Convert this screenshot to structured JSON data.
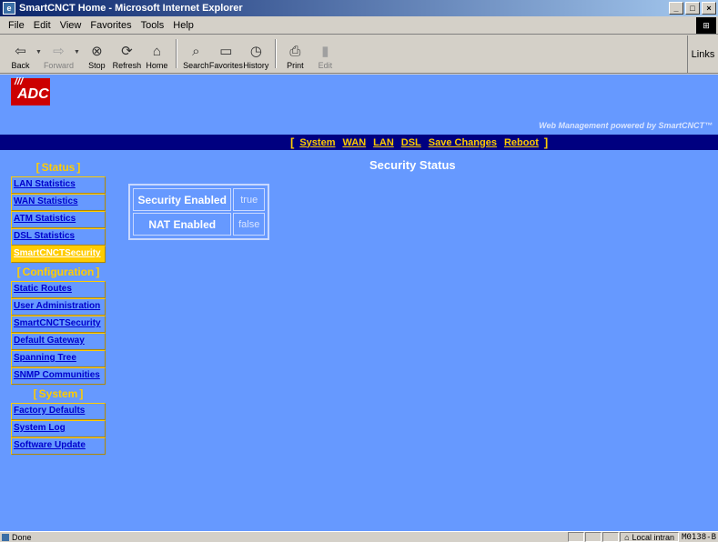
{
  "window": {
    "title": "SmartCNCT Home - Microsoft Internet Explorer",
    "controls": [
      "_",
      "□",
      "×"
    ]
  },
  "menu": [
    "File",
    "Edit",
    "View",
    "Favorites",
    "Tools",
    "Help"
  ],
  "toolbar": {
    "buttons": [
      {
        "label": "Back",
        "icon": "back-arrow-icon"
      },
      {
        "label": "Forward",
        "icon": "forward-arrow-icon"
      },
      {
        "label": "Stop",
        "icon": "stop-icon"
      },
      {
        "label": "Refresh",
        "icon": "refresh-icon"
      },
      {
        "label": "Home",
        "icon": "home-icon"
      },
      {
        "label": "Search",
        "icon": "search-icon"
      },
      {
        "label": "Favorites",
        "icon": "favorites-icon"
      },
      {
        "label": "History",
        "icon": "history-icon"
      },
      {
        "label": "Print",
        "icon": "print-icon"
      },
      {
        "label": "Edit",
        "icon": "edit-icon"
      }
    ],
    "links_label": "Links"
  },
  "header": {
    "logo_text": "ADC",
    "powered_by": "Web Management powered by SmartCNCT™"
  },
  "nav": {
    "items": [
      "System",
      "WAN",
      "LAN",
      "DSL",
      "Save Changes",
      "Reboot"
    ]
  },
  "page": {
    "title": "Security Status"
  },
  "sidebar": {
    "status_heading": "Status",
    "status_items": [
      "LAN Statistics",
      "WAN Statistics",
      "ATM Statistics",
      "DSL Statistics",
      "SmartCNCTSecurity"
    ],
    "config_heading": "Configuration",
    "config_items": [
      "Static Routes",
      "User Administration",
      "SmartCNCTSecurity",
      "Default Gateway",
      "Spanning Tree",
      "SNMP Communities"
    ],
    "system_heading": "System",
    "system_items": [
      "Factory Defaults",
      "System Log",
      "Software Update"
    ]
  },
  "status_table": {
    "rows": [
      {
        "label": "Security Enabled",
        "value": "true"
      },
      {
        "label": "NAT Enabled",
        "value": "false"
      }
    ]
  },
  "statusbar": {
    "status": "Done",
    "zone": "Local intran",
    "code": "M0138-B"
  },
  "colors": {
    "page_bg": "#6699ff",
    "nav_bg": "#000080",
    "accent": "#ffcc00",
    "logo_red": "#cc0000"
  }
}
